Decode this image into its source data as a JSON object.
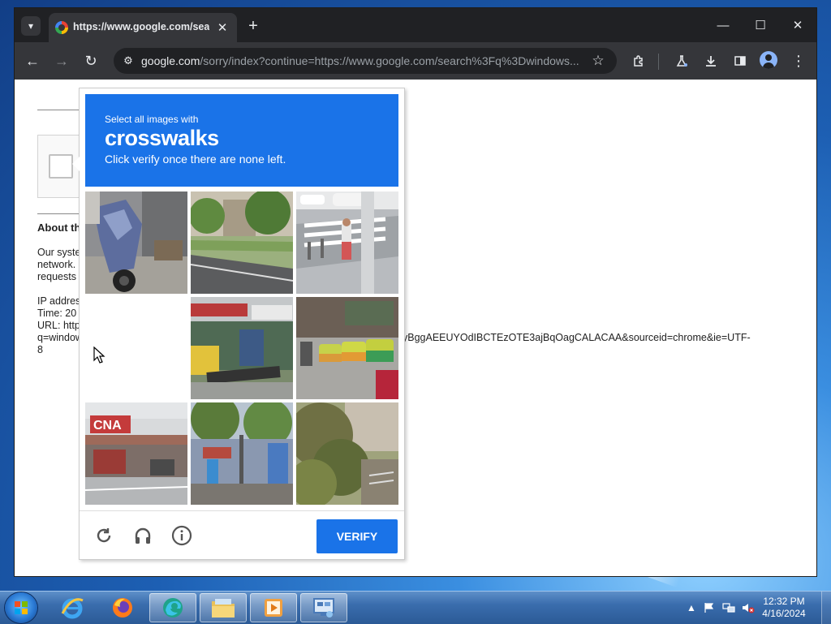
{
  "browser": {
    "tab_title": "https://www.google.com/search",
    "url_host": "google.com",
    "url_path": "/sorry/index?continue=https://www.google.com/search%3Fq%3Dwindows..."
  },
  "page": {
    "about_title": "About th",
    "text_lines": [
      "Our syste",
      "network.",
      "requests",
      "",
      "IP addres",
      "Time: 20",
      "URL: http",
      "q=window",
      "8"
    ],
    "url_tail": "yBggAEEUYOdIBCTEzOTE3ajBqOagCALACAA&sourceid=chrome&ie=UTF-"
  },
  "challenge": {
    "instruction_line1": "Select all images with",
    "target_word": "crosswalks",
    "instruction_line3": "Click verify once there are none left.",
    "tiles": [
      {
        "scene": "motor scooter parked on pavement",
        "blank": false
      },
      {
        "scene": "park and tree-lined road",
        "blank": false
      },
      {
        "scene": "crosswalk with pedestrian and bollards",
        "blank": false
      },
      {
        "scene": "loading tile",
        "blank": true
      },
      {
        "scene": "market stalls with parked motorbikes",
        "blank": false
      },
      {
        "scene": "street with taxis",
        "blank": false
      },
      {
        "scene": "gas station with CNA sign",
        "blank": false
      },
      {
        "scene": "storefronts with trees",
        "blank": false
      },
      {
        "scene": "tree and bushes",
        "blank": false
      }
    ],
    "cna_sign": "CNA",
    "verify_label": "VERIFY",
    "icons": [
      "reload-icon",
      "headphones-icon",
      "info-icon"
    ]
  },
  "taskbar": {
    "apps": [
      "internet-explorer",
      "firefox",
      "edge",
      "file-explorer",
      "media-player",
      "remote-desktop"
    ],
    "time": "12:32 PM",
    "date": "4/16/2024"
  },
  "colors": {
    "challenge_blue": "#1a73e8",
    "chrome_dark": "#35363a"
  }
}
